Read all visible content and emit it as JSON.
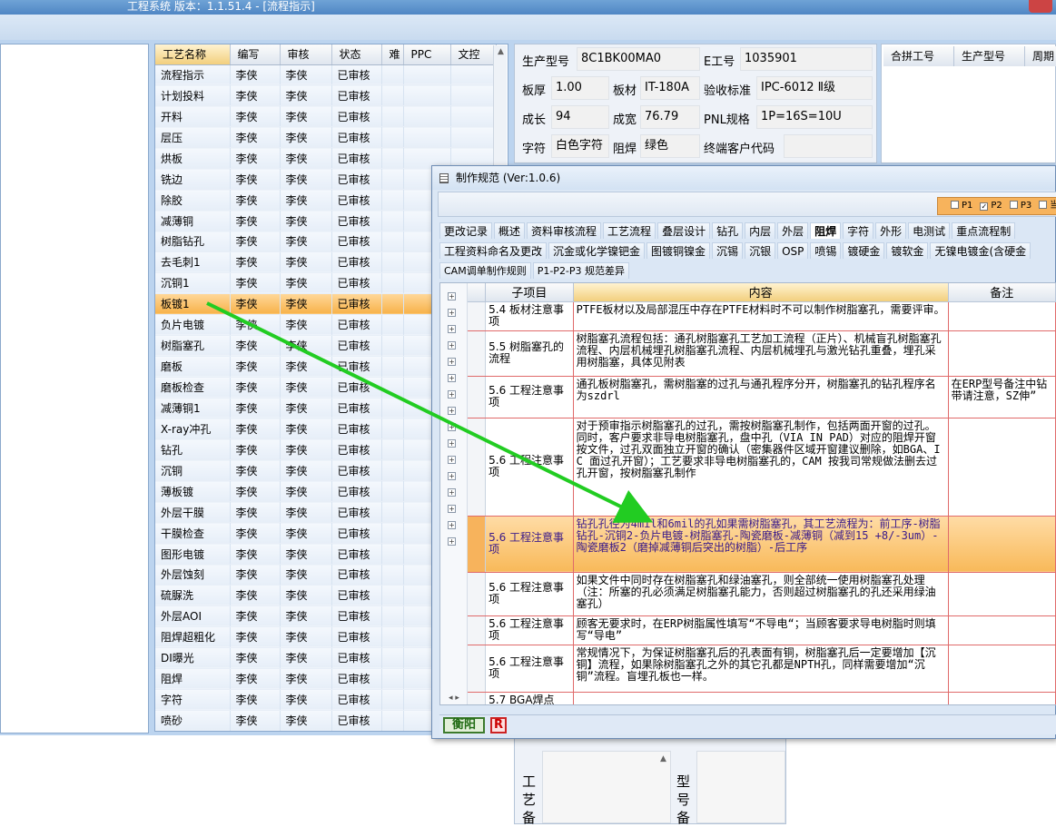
{
  "window": {
    "title": "工程系统   版本：1.1.51.4 - [流程指示]"
  },
  "process_table": {
    "headers": [
      "工艺名称",
      "编写",
      "审核",
      "状态",
      "难",
      "PPC",
      "文控"
    ],
    "rows": [
      [
        "流程指示",
        "李侠",
        "李侠",
        "已审核"
      ],
      [
        "计划投料",
        "李侠",
        "李侠",
        "已审核"
      ],
      [
        "开料",
        "李侠",
        "李侠",
        "已审核"
      ],
      [
        "层压",
        "李侠",
        "李侠",
        "已审核"
      ],
      [
        "烘板",
        "李侠",
        "李侠",
        "已审核"
      ],
      [
        "铣边",
        "李侠",
        "李侠",
        "已审核"
      ],
      [
        "除胶",
        "李侠",
        "李侠",
        "已审核"
      ],
      [
        "减薄铜",
        "李侠",
        "李侠",
        "已审核"
      ],
      [
        "树脂钻孔",
        "李侠",
        "李侠",
        "已审核"
      ],
      [
        "去毛刺1",
        "李侠",
        "李侠",
        "已审核"
      ],
      [
        "沉铜1",
        "李侠",
        "李侠",
        "已审核"
      ],
      [
        "板镀1",
        "李侠",
        "李侠",
        "已审核"
      ],
      [
        "负片电镀",
        "李侠",
        "李侠",
        "已审核"
      ],
      [
        "树脂塞孔",
        "李侠",
        "李侠",
        "已审核"
      ],
      [
        "磨板",
        "李侠",
        "李侠",
        "已审核"
      ],
      [
        "磨板检查",
        "李侠",
        "李侠",
        "已审核"
      ],
      [
        "减薄铜1",
        "李侠",
        "李侠",
        "已审核"
      ],
      [
        "X-ray冲孔",
        "李侠",
        "李侠",
        "已审核"
      ],
      [
        "钻孔",
        "李侠",
        "李侠",
        "已审核"
      ],
      [
        "沉铜",
        "李侠",
        "李侠",
        "已审核"
      ],
      [
        "薄板镀",
        "李侠",
        "李侠",
        "已审核"
      ],
      [
        "外层干膜",
        "李侠",
        "李侠",
        "已审核"
      ],
      [
        "干膜检查",
        "李侠",
        "李侠",
        "已审核"
      ],
      [
        "图形电镀",
        "李侠",
        "李侠",
        "已审核"
      ],
      [
        "外层蚀刻",
        "李侠",
        "李侠",
        "已审核"
      ],
      [
        "硫脲洗",
        "李侠",
        "李侠",
        "已审核"
      ],
      [
        "外层AOI",
        "李侠",
        "李侠",
        "已审核"
      ],
      [
        "阻焊超粗化",
        "李侠",
        "李侠",
        "已审核"
      ],
      [
        "DI曝光",
        "李侠",
        "李侠",
        "已审核"
      ],
      [
        "阻焊",
        "李侠",
        "李侠",
        "已审核"
      ],
      [
        "字符",
        "李侠",
        "李侠",
        "已审核"
      ],
      [
        "喷砂",
        "李侠",
        "李侠",
        "已审核"
      ]
    ],
    "selected_index": 11
  },
  "info": {
    "prod_model_label": "生产型号",
    "prod_model_value": "8C1BK00MA0",
    "e_no_label": "E工号",
    "e_no_value": "1035901",
    "thickness_label": "板厚",
    "thickness_value": "1.00",
    "material_label": "板材",
    "material_value": "IT-180A",
    "standard_label": "验收标准",
    "standard_value": "IPC-6012 Ⅱ级",
    "length_label": "成长",
    "length_value": "94",
    "width_label": "成宽",
    "width_value": "76.79",
    "pnl_label": "PNL规格",
    "pnl_value": "1P=16S=10U",
    "char_label": "字符",
    "char_value": "白色字符",
    "mask_label": "阻焊",
    "mask_value": "绿色",
    "customer_label": "终端客户代码",
    "customer_value": ""
  },
  "right_grid": {
    "headers": [
      "合拼工号",
      "生产型号",
      "周期"
    ]
  },
  "bottom": {
    "label_a": [
      "工",
      "艺",
      "备"
    ],
    "label_b": [
      "型",
      "号",
      "备"
    ]
  },
  "dialog": {
    "title": "制作规范 (Ver:1.0.6)",
    "p_options": [
      {
        "label": "P1",
        "checked": false
      },
      {
        "label": "P2",
        "checked": true
      },
      {
        "label": "P3",
        "checked": false
      },
      {
        "label": "当",
        "checked": false
      }
    ],
    "tabs_row1": [
      "更改记录",
      "概述",
      "资料审核流程",
      "工艺流程",
      "叠层设计",
      "钻孔",
      "内层",
      "外层",
      "阻焊",
      "字符",
      "外形",
      "电测试",
      "重点流程制"
    ],
    "active_tab": "阻焊",
    "tabs_row2": [
      "工程资料命名及更改",
      "沉金或化学镍钯金",
      "图镀铜镍金",
      "沉锡",
      "沉银",
      "OSP",
      "喷锡",
      "镀硬金",
      "镀软金",
      "无镍电镀金(含硬金"
    ],
    "tabs_row3": [
      "CAM调单制作规则",
      "P1-P2-P3 规范差异"
    ],
    "columns": [
      "子项目",
      "内容",
      "备注"
    ],
    "rows": [
      {
        "sub": "5.4 板材注意事项",
        "content": "PTFE板材以及局部混压中存在PTFE材料时不可以制作树脂塞孔，需要评审。",
        "note": ""
      },
      {
        "sub": "5.5 树脂塞孔的流程",
        "content": "树脂塞孔流程包括：通孔树脂塞孔工艺加工流程（正片）、机械盲孔树脂塞孔流程、内层机械埋孔树脂塞孔流程、内层机械埋孔与激光钻孔重叠，埋孔采用树脂塞，具体见附表",
        "note": ""
      },
      {
        "sub": "5.6 工程注意事项",
        "content": "通孔板树脂塞孔，需树脂塞的过孔与通孔程序分开，树脂塞孔的钻孔程序名为szdrl",
        "note": "在ERP型号备注中钻带请注意，SZ伸”"
      },
      {
        "sub": "5.6 工程注意事项",
        "content": "对于预审指示树脂塞孔的过孔，需按树脂塞孔制作，包括两面开窗的过孔。同时，客户要求非导电树脂塞孔，盘中孔（VIA IN PAD）对应的阻焊开窗按文件，过孔双面独立开窗的确认（密集器件区域开窗建议删除，如BGA、IC 面过孔开窗）；工艺要求非导电树脂塞孔的，CAM 按我司常规做法删去过孔开窗，按树脂塞孔制作",
        "note": ""
      },
      {
        "sub": "5.6 工程注意事项",
        "content": "钻孔孔径为4mil和6mil的孔如果需树脂塞孔，其工艺流程为：前工序-树脂钻孔-沉铜2-负片电镀-树脂塞孔-陶瓷磨板-减薄铜（减到15 +8/-3um）-陶瓷磨板2（磨掉减薄铜后突出的树脂）-后工序",
        "note": ""
      },
      {
        "sub": "5.6 工程注意事项",
        "content": "如果文件中同时存在树脂塞孔和绿油塞孔，则全部统一使用树脂塞孔处理（注：所塞的孔必须满足树脂塞孔能力，否则超过树脂塞孔的孔还采用绿油塞孔）",
        "note": ""
      },
      {
        "sub": "5.6 工程注意事项",
        "content": "顾客无要求时，在ERP树脂属性填写“不导电“；当顾客要求导电树脂时则填写“导电”",
        "note": ""
      },
      {
        "sub": "5.6 工程注意事项",
        "content": "常规情况下，为保证树脂塞孔后的孔表面有铜，树脂塞孔后一定要增加【沉铜】流程，如果除树脂塞孔之外的其它孔都是NPTH孔，同样需要增加“沉铜”流程。盲埋孔板也一样。",
        "note": ""
      },
      {
        "sub": "5.7 BGA焊点",
        "content": "",
        "note": ""
      }
    ],
    "selected_row": 4,
    "status_green": "衡阳",
    "status_red": "R"
  },
  "colors": {
    "selection": "#f7b24a",
    "arrow": "#22cc22",
    "grid_line": "#e06a6a",
    "selected_text": "#3a1a8a"
  }
}
